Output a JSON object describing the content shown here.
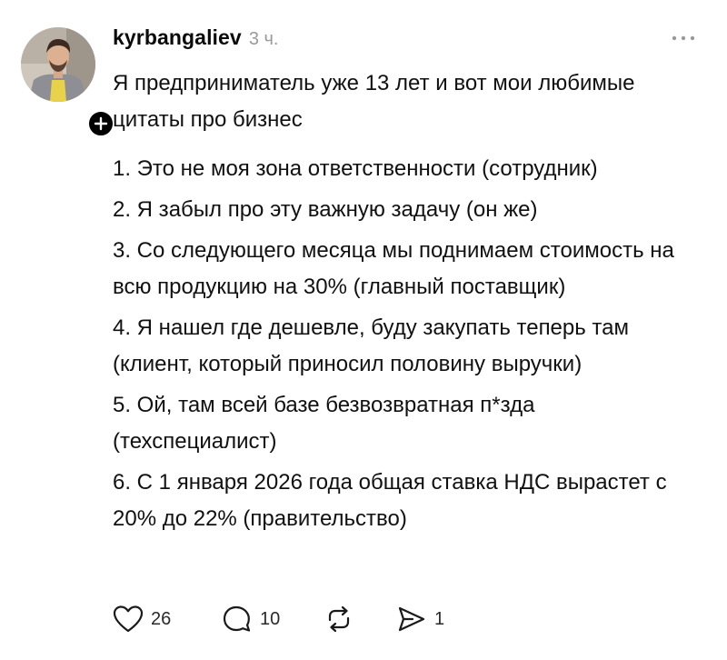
{
  "post": {
    "username": "kyrbangaliev",
    "timestamp": "3 ч.",
    "intro": "Я предприниматель уже 13 лет и вот мои любимые цитаты про бизнес",
    "items": [
      "1. Это не моя зона ответственности (сотрудник)",
      "2. Я забыл про эту важную задачу (он же)",
      "3. Со следующего месяца мы поднимаем стоимость на всю продукцию на 30% (главный поставщик)",
      "4. Я нашел где дешевле, буду закупать теперь там (клиент, который приносил половину выручки)",
      "5. Ой, там всей базе безвозвратная п*зда (техспециалист)",
      "6. С 1 января 2026 года общая ставка НДС вырастет с 20% до 22% (правительство)"
    ]
  },
  "actions": {
    "likes": "26",
    "replies": "10",
    "shares": "1"
  },
  "icons": {
    "follow": "plus-icon",
    "more": "more-horizontal-icon",
    "like": "heart-icon",
    "reply": "comment-icon",
    "repost": "repost-icon",
    "share": "send-icon"
  }
}
